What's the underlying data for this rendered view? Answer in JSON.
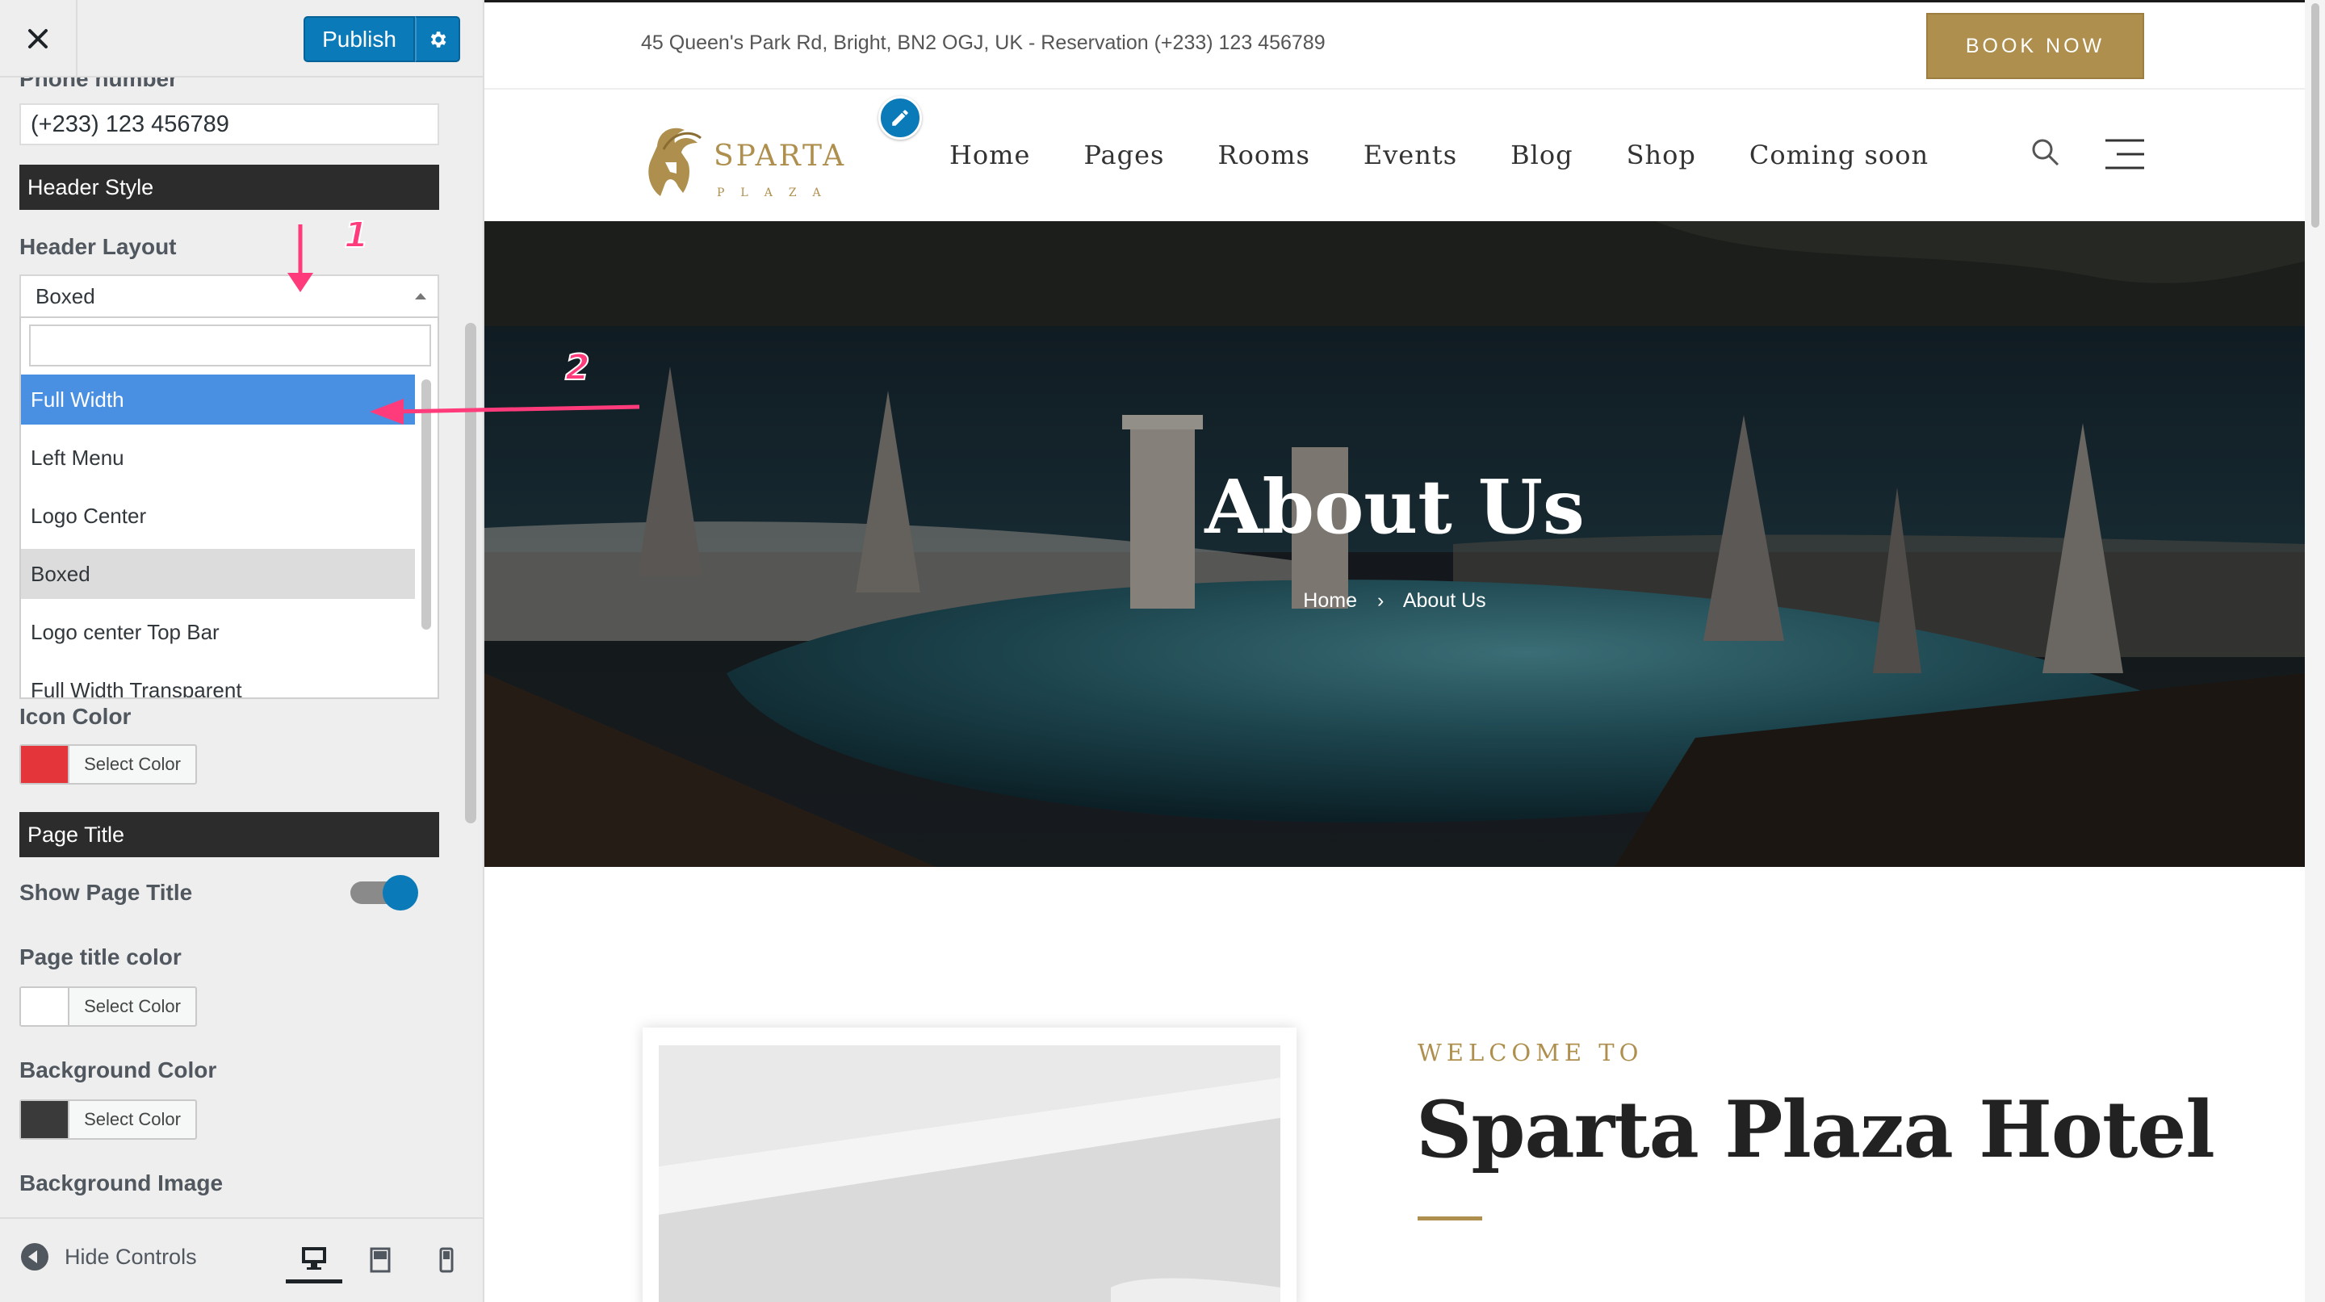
{
  "panel": {
    "publish_label": "Publish",
    "phone_label": "Phone number",
    "phone_value": "(+233) 123 456789",
    "header_style_section": "Header Style",
    "header_layout_label": "Header Layout",
    "header_layout_value": "Boxed",
    "dropdown_search_value": "",
    "dropdown_options": [
      "Full Width",
      "Left Menu",
      "Logo Center",
      "Boxed",
      "Logo center Top Bar",
      "Full Width Transparent"
    ],
    "icon_color_label": "Icon Color",
    "select_color_label": "Select Color",
    "page_title_section": "Page Title",
    "show_page_title_label": "Show Page Title",
    "show_page_title_on": true,
    "page_title_color_label": "Page title color",
    "background_color_label": "Background Color",
    "background_image_label": "Background Image",
    "hide_controls_label": "Hide Controls",
    "colors": {
      "icon_color": "#e4353a",
      "page_title_color": "#ffffff",
      "background_color": "#3a3a3a",
      "accent": "#0a7ab8"
    }
  },
  "annotations": {
    "step1": "1",
    "step2": "2",
    "color": "#ff3b7b"
  },
  "site": {
    "address": "45 Queen's Park Rd, Bright, BN2 OGJ, UK",
    "reservation": "Reservation (+233) 123 456789",
    "book_now": "BOOK NOW",
    "logo_name": "SPARTA",
    "logo_sub": "PLAZA",
    "menu": [
      "Home",
      "Pages",
      "Rooms",
      "Events",
      "Blog",
      "Shop",
      "Coming soon"
    ],
    "hero_title": "About Us",
    "breadcrumb_home": "Home",
    "breadcrumb_sep": "›",
    "breadcrumb_current": "About Us",
    "welcome": "WELCOME TO",
    "hotel_title": "Sparta Plaza Hotel",
    "brand_gold": "#ae8f4d"
  }
}
